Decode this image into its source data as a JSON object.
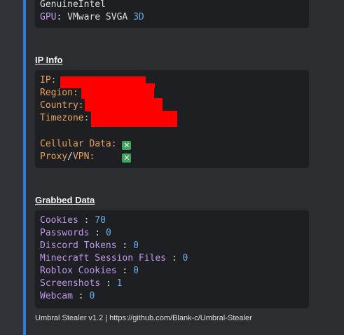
{
  "system": {
    "cpu_line": "GenuineIntel",
    "gpu_label": "GPU",
    "gpu_value_1": "VMware SVGA",
    "gpu_value_num": "3D"
  },
  "ip_info": {
    "title": "IP Info",
    "ip_label": "IP:",
    "region_label": "Region:",
    "country_label": "Country:",
    "timezone_label": "Timezone:",
    "cellular_label": "Cellular Data:",
    "cellular_icon": "x-box-icon",
    "proxy_label_1": "Proxy",
    "proxy_label_sep": "/",
    "proxy_label_2": "VPN:",
    "proxy_icon": "x-box-icon",
    "redact_color": "#ff0000"
  },
  "grabbed": {
    "title": "Grabbed Data",
    "items": [
      {
        "label": "Cookies",
        "sep": " : ",
        "value": "70"
      },
      {
        "label": "Passwords",
        "sep": " : ",
        "value": "0"
      },
      {
        "label": "Discord Tokens",
        "sep": " : ",
        "value": "0"
      },
      {
        "label": "Minecraft Session Files",
        "sep": " : ",
        "value": "0"
      },
      {
        "label": "Roblox Cookies",
        "sep": " : ",
        "value": "0"
      },
      {
        "label": "Screenshots",
        "sep": " : ",
        "value": "1"
      },
      {
        "label": "Webcam",
        "sep": " : ",
        "value": "0"
      }
    ]
  },
  "footer": {
    "text": "Umbral Stealer v1.2 | https://github.com/Blank-c/Umbral-Stealer"
  },
  "colors": {
    "embed_bar": "#2d7bdc",
    "label_purple": "#c297ea",
    "label_orange": "#e8a25e",
    "value_blue": "#6aaee8",
    "check_green": "#3ba55c"
  }
}
